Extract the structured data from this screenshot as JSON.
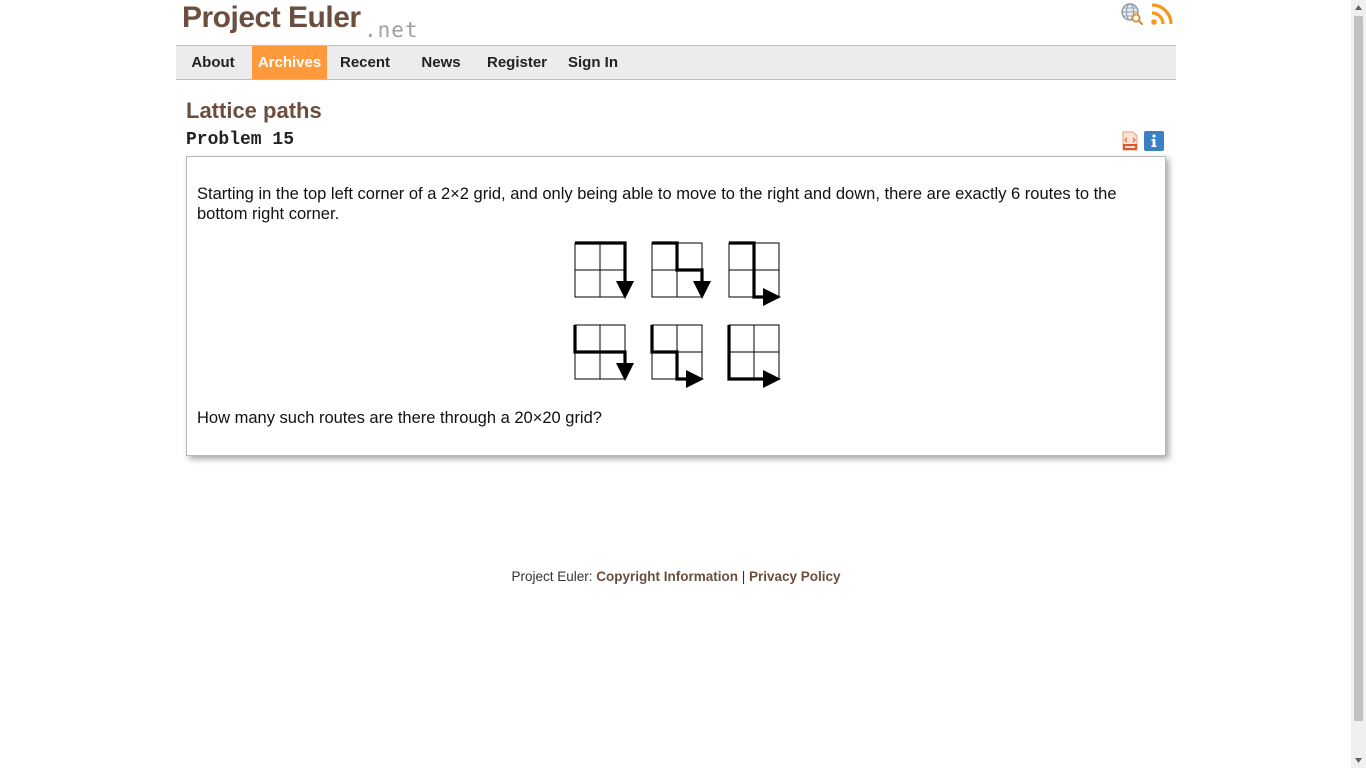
{
  "header": {
    "logo_main": "Project Euler",
    "logo_net": ".net",
    "icons": [
      "search-globe-icon",
      "rss-feed-icon"
    ]
  },
  "nav": {
    "items": [
      {
        "label": "About"
      },
      {
        "label": "Archives",
        "active": true
      },
      {
        "label": "Recent"
      },
      {
        "label": "News"
      },
      {
        "label": "Register"
      },
      {
        "label": "Sign In"
      }
    ]
  },
  "problem": {
    "title": "Lattice paths",
    "number": "Problem 15",
    "icons": [
      "html-source-icon",
      "info-icon"
    ],
    "text1": "Starting in the top left corner of a 2×2 grid, and only being able to move to the right and down, there are exactly 6 routes to the bottom right corner.",
    "text2": "How many such routes are there through a 20×20 grid?"
  },
  "footer": {
    "prefix": "Project Euler: ",
    "link1": "Copyright Information",
    "separator": " | ",
    "link2": "Privacy Policy"
  },
  "colors": {
    "brand": "#6b4e3d",
    "accent": "#ff9a3c",
    "info": "#3b7fc4"
  }
}
